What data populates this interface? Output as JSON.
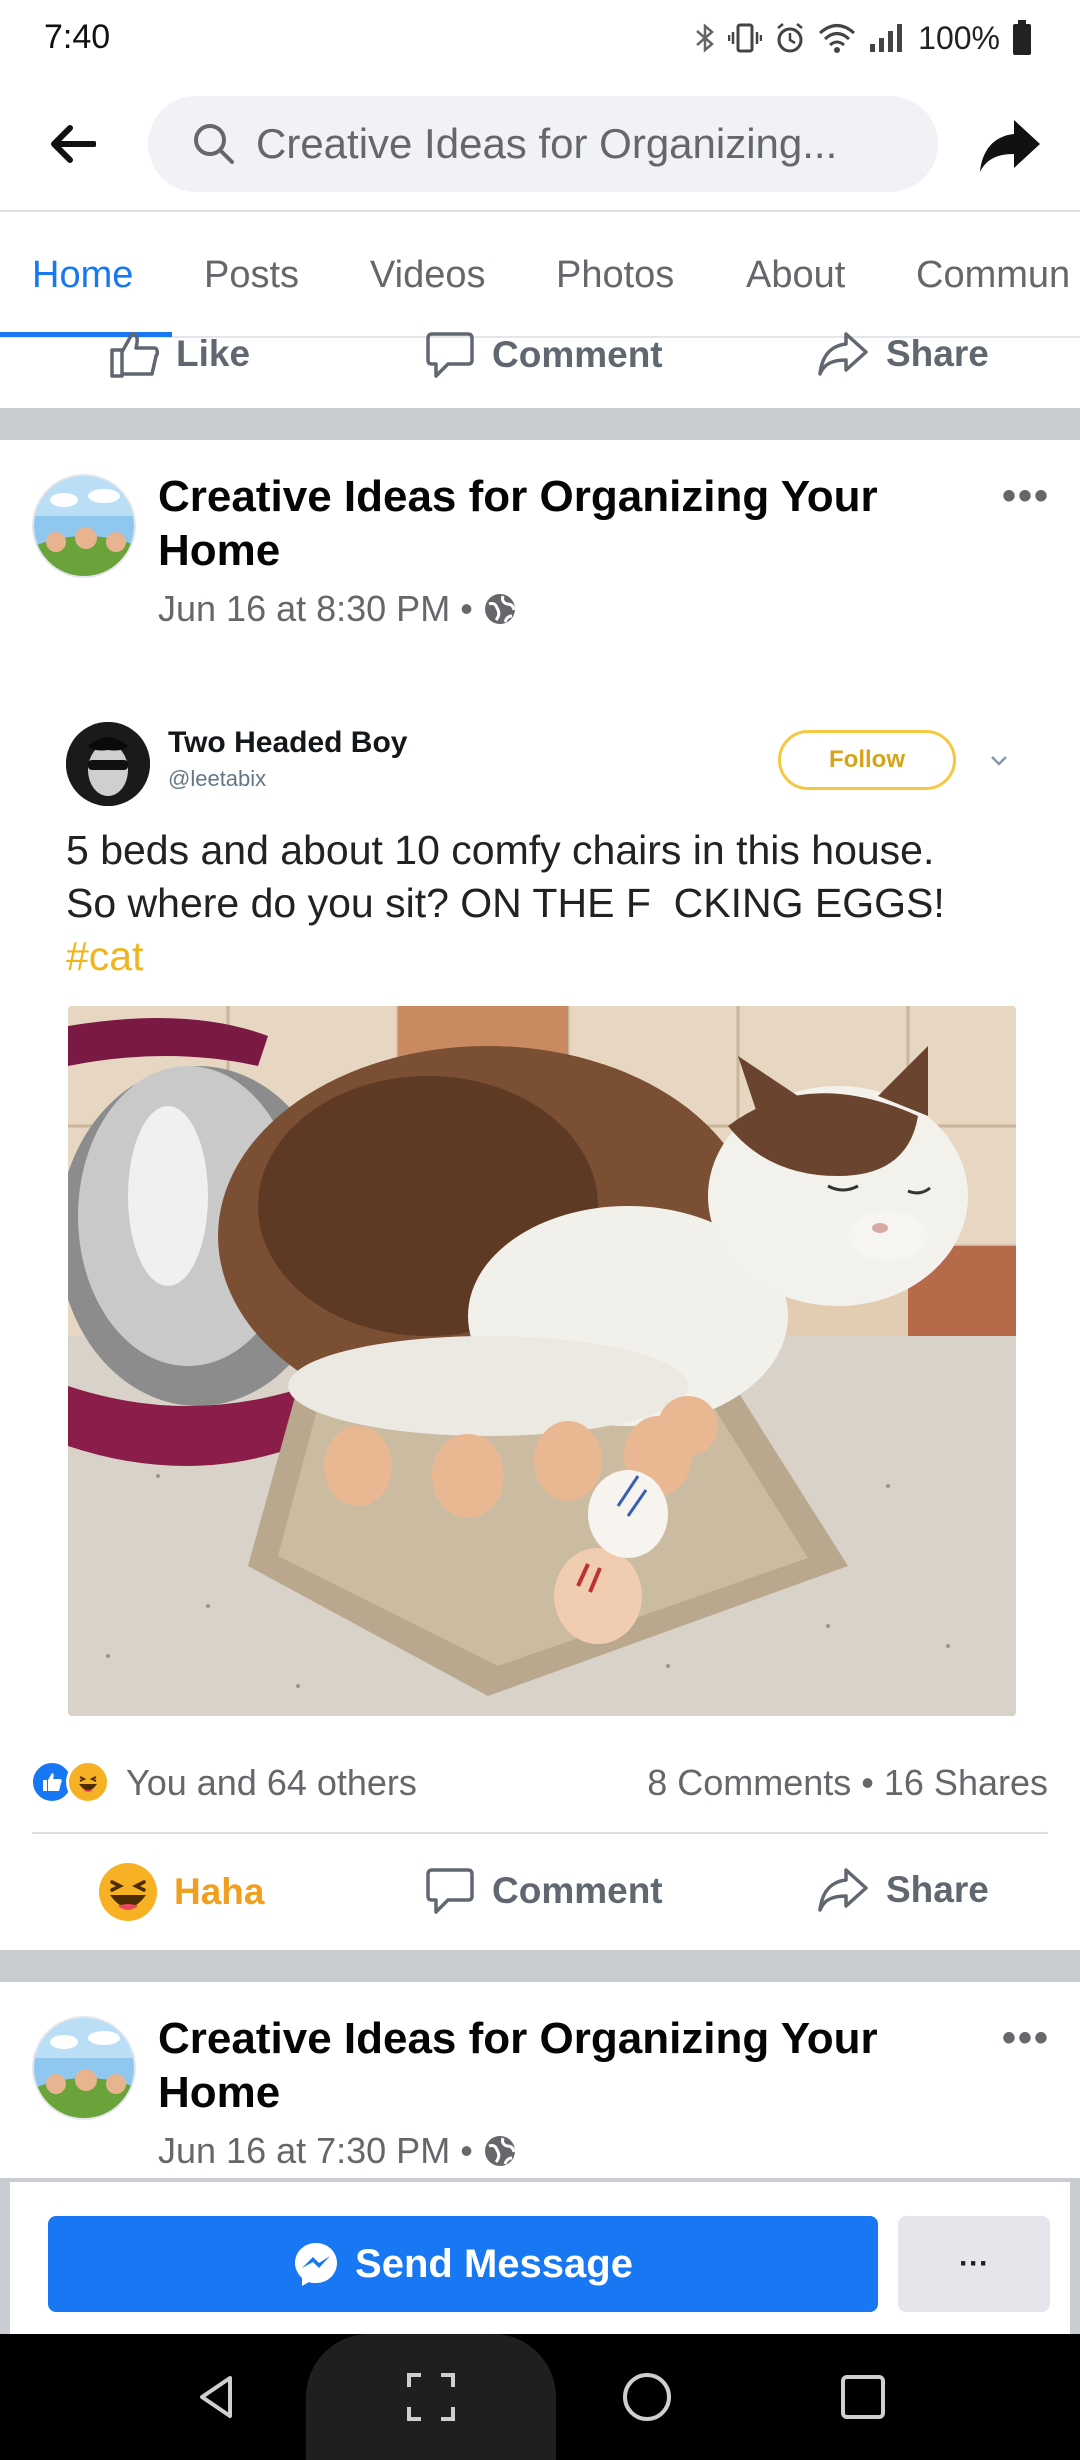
{
  "status_bar": {
    "time": "7:40",
    "battery": "100%",
    "icons": [
      "bluetooth-icon",
      "vibrate-icon",
      "alarm-icon",
      "wifi-icon",
      "signal-icon",
      "battery-icon"
    ]
  },
  "top_nav": {
    "search_text": "Creative Ideas for Organizing..."
  },
  "tabs": [
    {
      "label": "Home",
      "active": true
    },
    {
      "label": "Posts"
    },
    {
      "label": "Videos"
    },
    {
      "label": "Photos"
    },
    {
      "label": "About"
    },
    {
      "label": "Commun"
    }
  ],
  "partial_actions": {
    "like": "Like",
    "comment": "Comment",
    "share": "Share"
  },
  "post1": {
    "page_name": "Creative Ideas for Organizing Your Home",
    "timestamp": "Jun 16 at 8:30 PM",
    "dot": "•",
    "tweet": {
      "name": "Two Headed Boy",
      "handle": "@leetabix",
      "follow": "Follow",
      "text": "5 beds and about 10 comfy chairs in this house. So where do you sit? ON THE F  CKING EGGS! ",
      "hashtag": "#cat"
    },
    "reactions_text": "You and 64 others",
    "stats": "8 Comments • 16 Shares",
    "actions": {
      "haha": "Haha",
      "comment": "Comment",
      "share": "Share"
    }
  },
  "post2": {
    "page_name": "Creative Ideas for Organizing Your Home",
    "timestamp": "Jun 16 at 7:30 PM",
    "dot": "•"
  },
  "cta": {
    "send_message": "Send Message",
    "more": "···"
  },
  "colors": {
    "accent": "#1877f2",
    "haha": "#f7b125",
    "hashtag": "#f0b41e"
  }
}
